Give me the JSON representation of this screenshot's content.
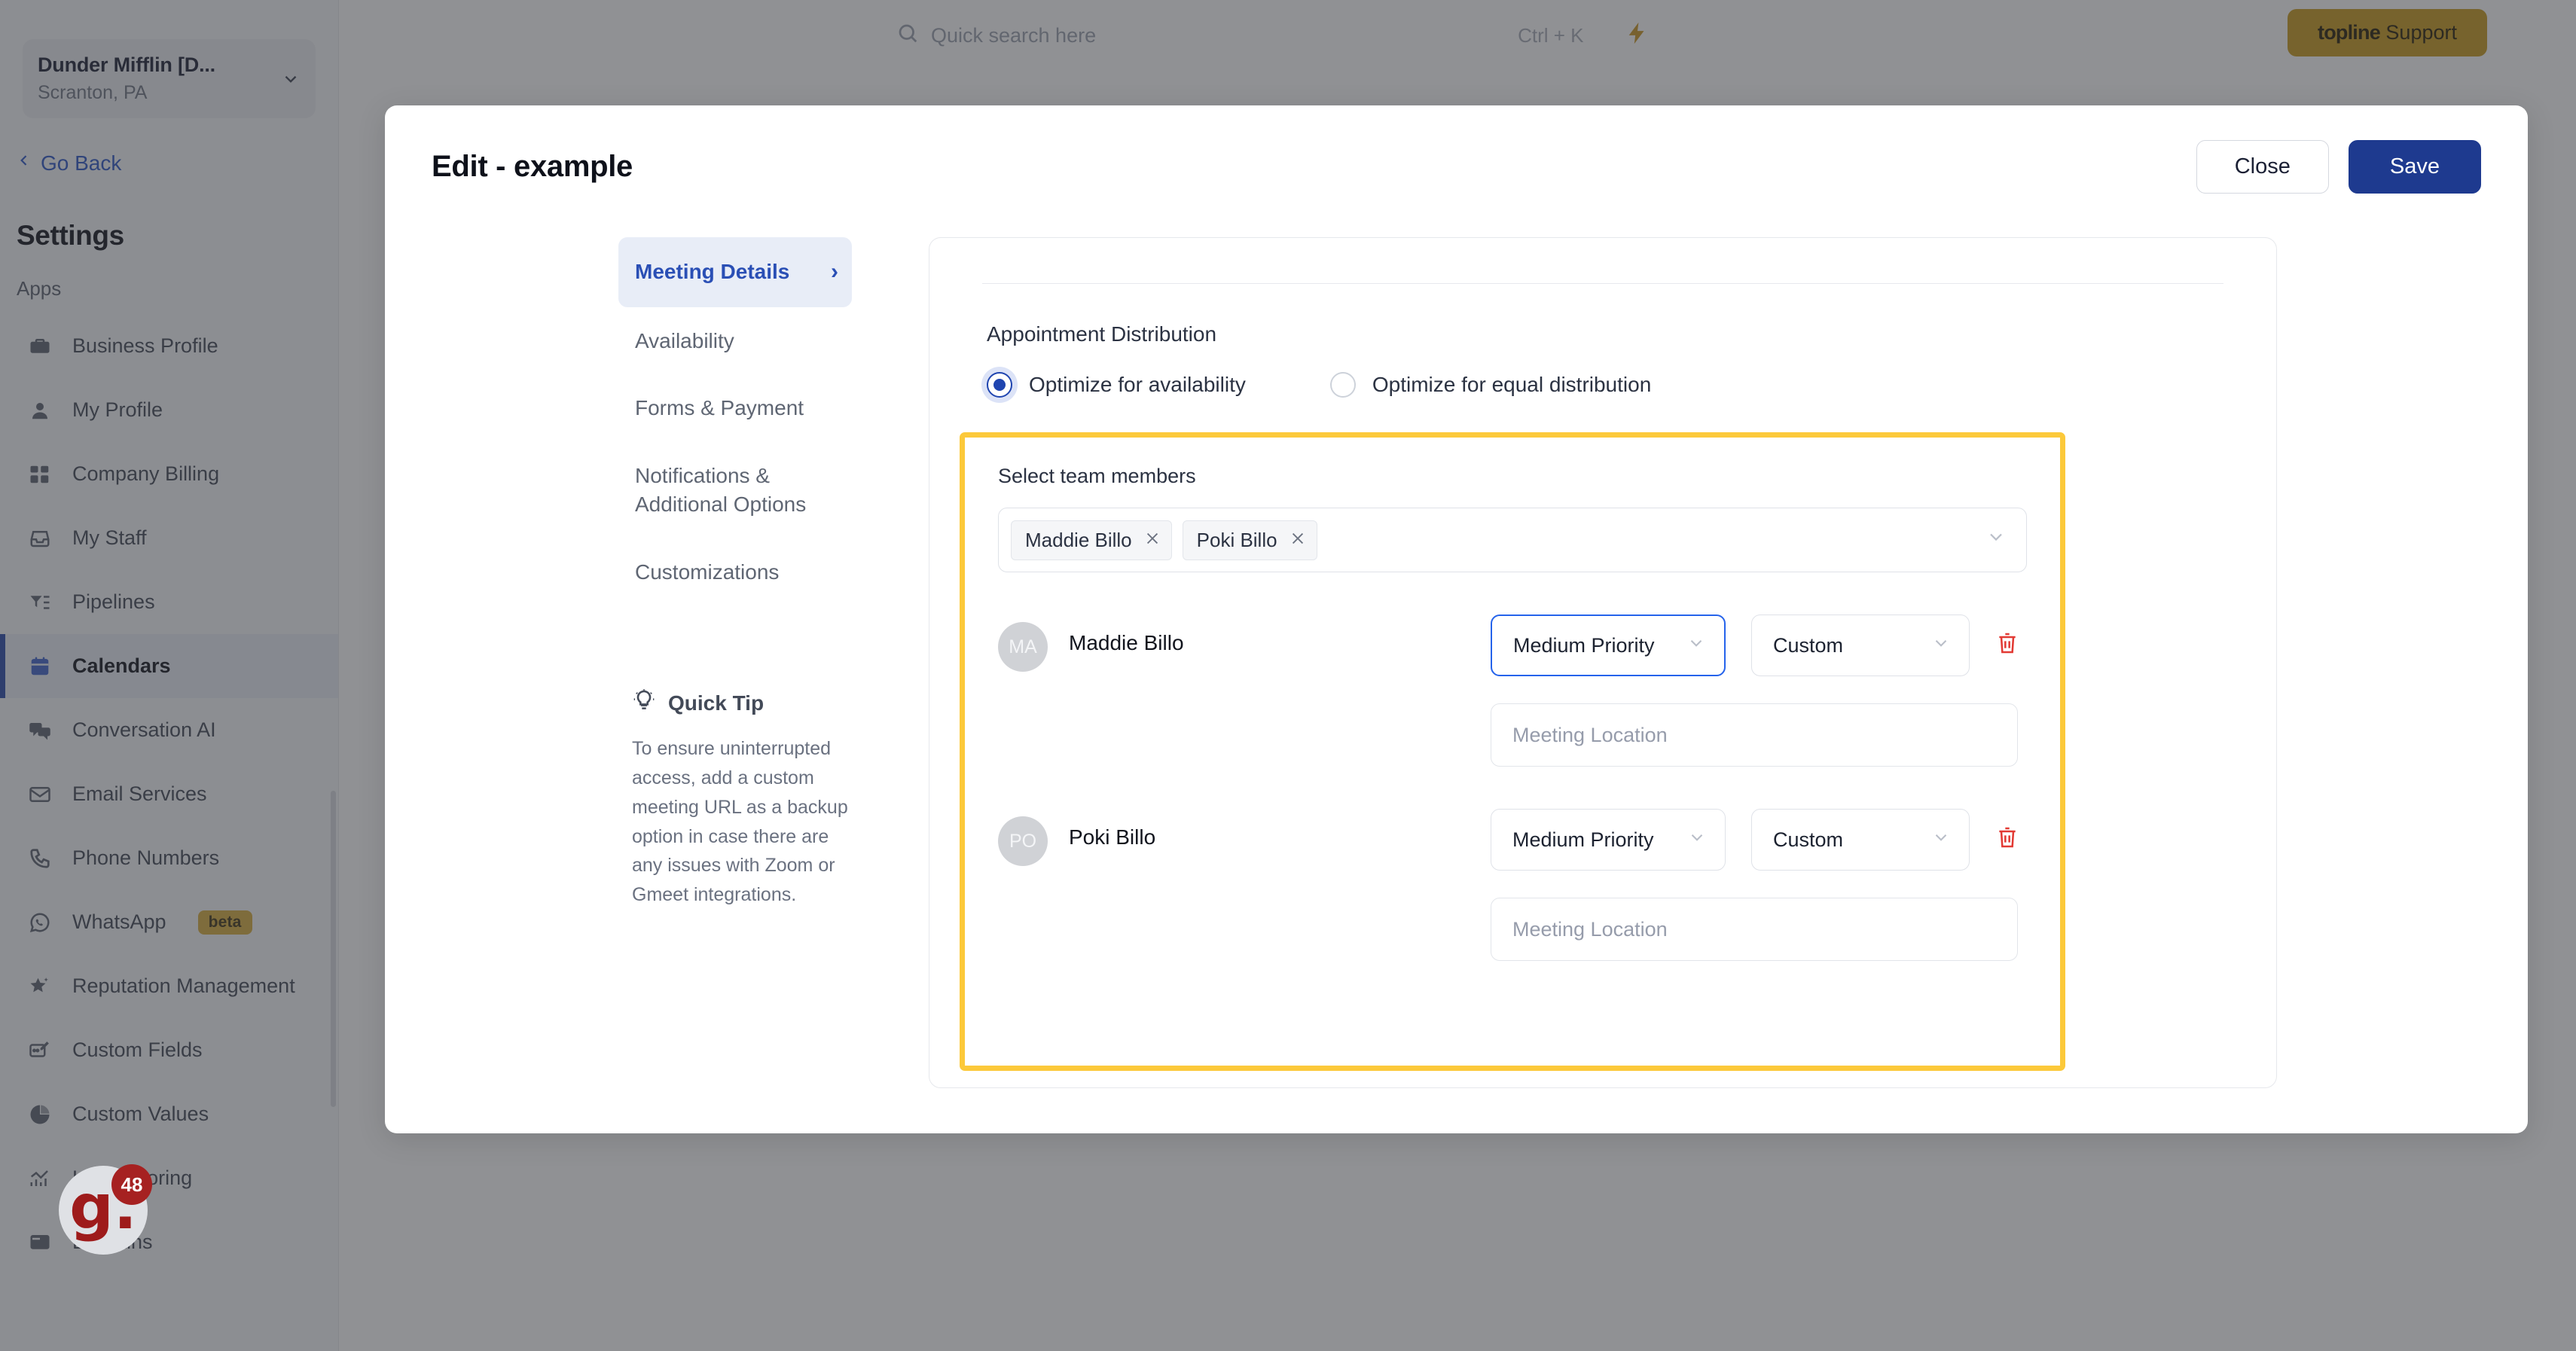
{
  "topbar": {
    "search_placeholder": "Quick search here",
    "search_icon": "search-icon",
    "shortcut": "Ctrl + K",
    "bolt_icon": "lightning-bolt-icon",
    "support_label_brand": "topline",
    "support_label_rest": " Support"
  },
  "sidebar": {
    "location": {
      "name": "Dunder Mifflin [D...",
      "sub": "Scranton, PA",
      "chevron_icon": "chevron-down-icon"
    },
    "go_back": "Go Back",
    "settings_title": "Settings",
    "group_label": "Apps",
    "items": [
      {
        "label": "Business Profile",
        "icon": "briefcase-icon"
      },
      {
        "label": "My Profile",
        "icon": "user-icon"
      },
      {
        "label": "Company Billing",
        "icon": "calculator-icon"
      },
      {
        "label": "My Staff",
        "icon": "inbox-icon"
      },
      {
        "label": "Pipelines",
        "icon": "filter-list-icon"
      },
      {
        "label": "Calendars",
        "icon": "calendar-icon"
      },
      {
        "label": "Conversation AI",
        "icon": "chat-bubbles-icon"
      },
      {
        "label": "Email Services",
        "icon": "envelope-icon"
      },
      {
        "label": "Phone Numbers",
        "icon": "phone-icon"
      },
      {
        "label": "WhatsApp",
        "icon": "whatsapp-icon",
        "badge": "beta"
      },
      {
        "label": "Reputation Management",
        "icon": "star-sparkle-icon"
      },
      {
        "label": "Custom Fields",
        "icon": "field-edit-icon"
      },
      {
        "label": "Custom Values",
        "icon": "pie-chart-icon"
      },
      {
        "label": "Lead Scoring",
        "icon": "chart-bars-icon"
      },
      {
        "label": "Domains",
        "icon": "browser-window-icon"
      }
    ],
    "active_item": "Calendars",
    "chat_widget": {
      "letter": "g.",
      "badge": "48"
    }
  },
  "modal": {
    "title": "Edit - example",
    "close_label": "Close",
    "save_label": "Save",
    "nav": [
      {
        "label": "Meeting Details",
        "chevron": "›"
      },
      {
        "label": "Availability"
      },
      {
        "label": "Forms & Payment"
      },
      {
        "label": "Notifications & Additional Options"
      },
      {
        "label": "Customizations"
      }
    ],
    "active_nav": "Meeting Details",
    "quick_tip": {
      "icon": "lightbulb-icon",
      "title": "Quick Tip",
      "body": "To ensure uninterrupted access, add a custom meeting URL as a backup option in case there are any issues with Zoom or Gmeet integrations."
    }
  },
  "content": {
    "distribution_label": "Appointment Distribution",
    "radio_options": [
      {
        "label": "Optimize for availability",
        "selected": true
      },
      {
        "label": "Optimize for equal distribution",
        "selected": false
      }
    ],
    "team_section": {
      "label": "Select team members",
      "highlight_color": "#fcc93a",
      "tags": [
        {
          "label": "Maddie Billo",
          "remove_icon": "close-icon"
        },
        {
          "label": "Poki Billo",
          "remove_icon": "close-icon"
        }
      ],
      "field_chevron_icon": "chevron-down-icon",
      "members": [
        {
          "initials": "MA",
          "name": "Maddie Billo",
          "priority": "Medium Priority",
          "priority_focused": true,
          "meeting_type": "Custom",
          "location_placeholder": "Meeting Location",
          "delete_icon": "trash-icon"
        },
        {
          "initials": "PO",
          "name": "Poki Billo",
          "priority": "Medium Priority",
          "priority_focused": false,
          "meeting_type": "Custom",
          "location_placeholder": "Meeting Location",
          "delete_icon": "trash-icon"
        }
      ]
    }
  }
}
